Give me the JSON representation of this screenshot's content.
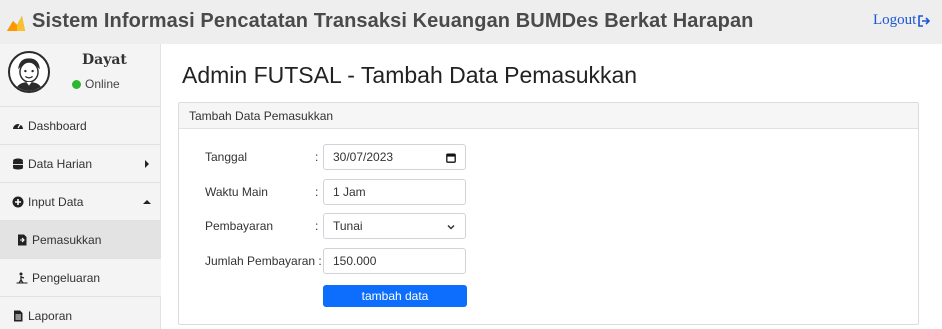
{
  "header": {
    "title": "Sistem Informasi Pencatatan Transaksi Keuangan BUMDes Berkat Harapan",
    "logout_label": "Logout"
  },
  "user": {
    "name": "Dayat",
    "status": "Online"
  },
  "sidebar": {
    "items": [
      {
        "label": "Dashboard",
        "icon": "tachometer-icon"
      },
      {
        "label": "Data Harian",
        "icon": "database-icon"
      },
      {
        "label": "Input Data",
        "icon": "plus-circle-icon"
      },
      {
        "label": "Pemasukkan",
        "icon": "file-import-icon"
      },
      {
        "label": "Pengeluaran",
        "icon": "person-carry-icon"
      },
      {
        "label": "Laporan",
        "icon": "file-text-icon"
      }
    ]
  },
  "main": {
    "page_title": "Admin FUTSAL - Tambah Data Pemasukkan",
    "card_title": "Tambah Data Pemasukkan",
    "form": {
      "tanggal": {
        "label": "Tanggal",
        "value": "30/07/2023"
      },
      "waktu_main": {
        "label": "Waktu Main",
        "value": "1 Jam"
      },
      "pembayaran": {
        "label": "Pembayaran",
        "value": "Tunai"
      },
      "jumlah": {
        "label": "Jumlah Pembayaran :",
        "value": "150.000"
      },
      "colon": ":",
      "submit_label": "tambah data"
    }
  },
  "colors": {
    "accent": "#0d6efd",
    "online": "#2cb631",
    "link": "#1a56d6",
    "header_bg": "#eeeeee",
    "sidebar_bg": "#f4f4f4"
  }
}
